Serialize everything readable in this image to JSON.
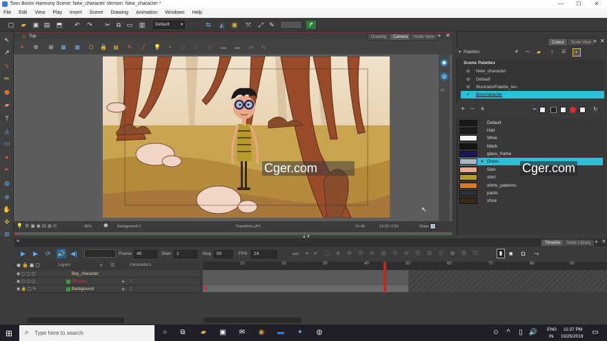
{
  "window": {
    "title": "Toon Boom Harmony Scene: New_character Version: New_character *",
    "minimize": "—",
    "maximize": "☐",
    "close": "✕"
  },
  "menu": [
    "File",
    "Edit",
    "View",
    "Play",
    "Insert",
    "Scene",
    "Drawing",
    "Animation",
    "Windows",
    "Help"
  ],
  "toolbar": {
    "workspace": "Default"
  },
  "view": {
    "breadcrumb": "Top",
    "tabs": [
      "Drawing",
      "Camera",
      "Node View"
    ],
    "active_tab": "Camera",
    "status": {
      "zoom": "40%",
      "layer": "Background-1",
      "mode": "Transform (A*)",
      "frame": "Fr 45",
      "coords": "14.52~2.92",
      "glass": "Glass"
    }
  },
  "right": {
    "tabs": [
      "Colour",
      "Node View"
    ],
    "section": "Palettes",
    "scene_palettes_title": "Scene Palettes",
    "palettes": [
      "New_character",
      "Default",
      "IllustratorPalette_rec",
      "Boycharacter"
    ],
    "selected_palette": "Boycharacter",
    "swatches": [
      {
        "name": "Default",
        "color": "#1a1a1a"
      },
      {
        "name": "Hair",
        "color": "#1b1b1b"
      },
      {
        "name": "Whie",
        "color": "#f6f6f6"
      },
      {
        "name": "black",
        "color": "#151515"
      },
      {
        "name": "glass_frame",
        "color": "#1a1a52"
      },
      {
        "name": "Glass",
        "color": "#aeb6c4"
      },
      {
        "name": "Skin",
        "color": "#e9a888"
      },
      {
        "name": "shirt",
        "color": "#b69a2c"
      },
      {
        "name": "shirts_patterns",
        "color": "#d77c26"
      },
      {
        "name": "pants",
        "color": "#30303a"
      },
      {
        "name": "shoe",
        "color": "#3a281c"
      }
    ],
    "selected_swatch": "Glass"
  },
  "timeline": {
    "tabs": [
      "Timeline",
      "Node Library"
    ],
    "frame_label": "Frame",
    "frame": "45",
    "start_label": "Start",
    "start": "1",
    "stop_label": "Stop",
    "stop": "50",
    "fps_label": "FPS",
    "fps": "24",
    "layers_label": "Layers",
    "parameters_label": "Parameters",
    "layers": [
      {
        "name": "Boy_character",
        "color": "#e8d8b0"
      },
      {
        "name": "Glasses",
        "color": "#d03030"
      },
      {
        "name": "Background",
        "color": "#e8d8b0"
      }
    ],
    "ruler": [
      "10",
      "20",
      "30",
      "40",
      "50",
      "60",
      "70",
      "80",
      "90"
    ]
  },
  "taskbar": {
    "search_placeholder": "Type here to search",
    "lang": "ENG",
    "region": "IN",
    "time": "11:37 PM",
    "date": "10/25/2019"
  },
  "watermark": "Cger.com"
}
